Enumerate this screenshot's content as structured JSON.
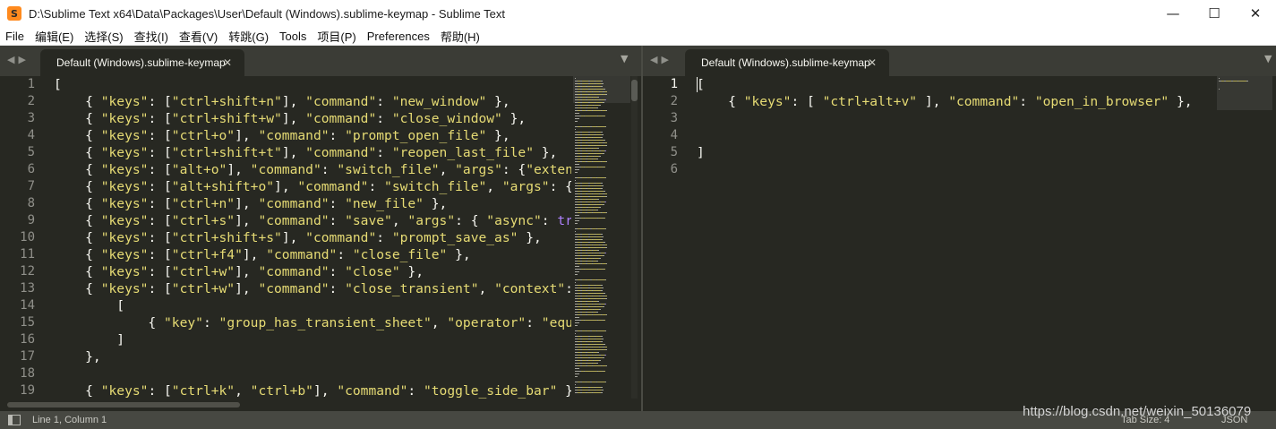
{
  "window": {
    "title": "D:\\Sublime Text x64\\Data\\Packages\\User\\Default (Windows).sublime-keymap - Sublime Text",
    "icon": "sublime-logo-icon",
    "controls": [
      "—",
      "☐",
      "✕"
    ]
  },
  "menu": [
    "File",
    "编辑(E)",
    "选择(S)",
    "查找(I)",
    "查看(V)",
    "转跳(G)",
    "Tools",
    "项目(P)",
    "Preferences",
    "帮助(H)"
  ],
  "left_pane": {
    "tab_label": "Default (Windows).sublime-keymap",
    "line_numbers": [
      "1",
      "2",
      "3",
      "4",
      "5",
      "6",
      "7",
      "8",
      "9",
      "10",
      "11",
      "12",
      "13",
      "14",
      "15",
      "16",
      "17",
      "18",
      "19"
    ],
    "lines": [
      [
        {
          "t": "[",
          "k": "p"
        }
      ],
      [
        {
          "t": "    { ",
          "k": "p"
        },
        {
          "t": "\"keys\"",
          "k": "s"
        },
        {
          "t": ": [",
          "k": "p"
        },
        {
          "t": "\"ctrl+shift+n\"",
          "k": "s"
        },
        {
          "t": "], ",
          "k": "p"
        },
        {
          "t": "\"command\"",
          "k": "s"
        },
        {
          "t": ": ",
          "k": "p"
        },
        {
          "t": "\"new_window\"",
          "k": "s"
        },
        {
          "t": " },",
          "k": "p"
        }
      ],
      [
        {
          "t": "    { ",
          "k": "p"
        },
        {
          "t": "\"keys\"",
          "k": "s"
        },
        {
          "t": ": [",
          "k": "p"
        },
        {
          "t": "\"ctrl+shift+w\"",
          "k": "s"
        },
        {
          "t": "], ",
          "k": "p"
        },
        {
          "t": "\"command\"",
          "k": "s"
        },
        {
          "t": ": ",
          "k": "p"
        },
        {
          "t": "\"close_window\"",
          "k": "s"
        },
        {
          "t": " },",
          "k": "p"
        }
      ],
      [
        {
          "t": "    { ",
          "k": "p"
        },
        {
          "t": "\"keys\"",
          "k": "s"
        },
        {
          "t": ": [",
          "k": "p"
        },
        {
          "t": "\"ctrl+o\"",
          "k": "s"
        },
        {
          "t": "], ",
          "k": "p"
        },
        {
          "t": "\"command\"",
          "k": "s"
        },
        {
          "t": ": ",
          "k": "p"
        },
        {
          "t": "\"prompt_open_file\"",
          "k": "s"
        },
        {
          "t": " },",
          "k": "p"
        }
      ],
      [
        {
          "t": "    { ",
          "k": "p"
        },
        {
          "t": "\"keys\"",
          "k": "s"
        },
        {
          "t": ": [",
          "k": "p"
        },
        {
          "t": "\"ctrl+shift+t\"",
          "k": "s"
        },
        {
          "t": "], ",
          "k": "p"
        },
        {
          "t": "\"command\"",
          "k": "s"
        },
        {
          "t": ": ",
          "k": "p"
        },
        {
          "t": "\"reopen_last_file\"",
          "k": "s"
        },
        {
          "t": " },",
          "k": "p"
        }
      ],
      [
        {
          "t": "    { ",
          "k": "p"
        },
        {
          "t": "\"keys\"",
          "k": "s"
        },
        {
          "t": ": [",
          "k": "p"
        },
        {
          "t": "\"alt+o\"",
          "k": "s"
        },
        {
          "t": "], ",
          "k": "p"
        },
        {
          "t": "\"command\"",
          "k": "s"
        },
        {
          "t": ": ",
          "k": "p"
        },
        {
          "t": "\"switch_file\"",
          "k": "s"
        },
        {
          "t": ", ",
          "k": "p"
        },
        {
          "t": "\"args\"",
          "k": "s"
        },
        {
          "t": ": {",
          "k": "p"
        },
        {
          "t": "\"exten",
          "k": "s"
        }
      ],
      [
        {
          "t": "    { ",
          "k": "p"
        },
        {
          "t": "\"keys\"",
          "k": "s"
        },
        {
          "t": ": [",
          "k": "p"
        },
        {
          "t": "\"alt+shift+o\"",
          "k": "s"
        },
        {
          "t": "], ",
          "k": "p"
        },
        {
          "t": "\"command\"",
          "k": "s"
        },
        {
          "t": ": ",
          "k": "p"
        },
        {
          "t": "\"switch_file\"",
          "k": "s"
        },
        {
          "t": ", ",
          "k": "p"
        },
        {
          "t": "\"args\"",
          "k": "s"
        },
        {
          "t": ": {",
          "k": "p"
        }
      ],
      [
        {
          "t": "    { ",
          "k": "p"
        },
        {
          "t": "\"keys\"",
          "k": "s"
        },
        {
          "t": ": [",
          "k": "p"
        },
        {
          "t": "\"ctrl+n\"",
          "k": "s"
        },
        {
          "t": "], ",
          "k": "p"
        },
        {
          "t": "\"command\"",
          "k": "s"
        },
        {
          "t": ": ",
          "k": "p"
        },
        {
          "t": "\"new_file\"",
          "k": "s"
        },
        {
          "t": " },",
          "k": "p"
        }
      ],
      [
        {
          "t": "    { ",
          "k": "p"
        },
        {
          "t": "\"keys\"",
          "k": "s"
        },
        {
          "t": ": [",
          "k": "p"
        },
        {
          "t": "\"ctrl+s\"",
          "k": "s"
        },
        {
          "t": "], ",
          "k": "p"
        },
        {
          "t": "\"command\"",
          "k": "s"
        },
        {
          "t": ": ",
          "k": "p"
        },
        {
          "t": "\"save\"",
          "k": "s"
        },
        {
          "t": ", ",
          "k": "p"
        },
        {
          "t": "\"args\"",
          "k": "s"
        },
        {
          "t": ": { ",
          "k": "p"
        },
        {
          "t": "\"async\"",
          "k": "s"
        },
        {
          "t": ": ",
          "k": "p"
        },
        {
          "t": "tr",
          "k": "c"
        }
      ],
      [
        {
          "t": "    { ",
          "k": "p"
        },
        {
          "t": "\"keys\"",
          "k": "s"
        },
        {
          "t": ": [",
          "k": "p"
        },
        {
          "t": "\"ctrl+shift+s\"",
          "k": "s"
        },
        {
          "t": "], ",
          "k": "p"
        },
        {
          "t": "\"command\"",
          "k": "s"
        },
        {
          "t": ": ",
          "k": "p"
        },
        {
          "t": "\"prompt_save_as\"",
          "k": "s"
        },
        {
          "t": " },",
          "k": "p"
        }
      ],
      [
        {
          "t": "    { ",
          "k": "p"
        },
        {
          "t": "\"keys\"",
          "k": "s"
        },
        {
          "t": ": [",
          "k": "p"
        },
        {
          "t": "\"ctrl+f4\"",
          "k": "s"
        },
        {
          "t": "], ",
          "k": "p"
        },
        {
          "t": "\"command\"",
          "k": "s"
        },
        {
          "t": ": ",
          "k": "p"
        },
        {
          "t": "\"close_file\"",
          "k": "s"
        },
        {
          "t": " },",
          "k": "p"
        }
      ],
      [
        {
          "t": "    { ",
          "k": "p"
        },
        {
          "t": "\"keys\"",
          "k": "s"
        },
        {
          "t": ": [",
          "k": "p"
        },
        {
          "t": "\"ctrl+w\"",
          "k": "s"
        },
        {
          "t": "], ",
          "k": "p"
        },
        {
          "t": "\"command\"",
          "k": "s"
        },
        {
          "t": ": ",
          "k": "p"
        },
        {
          "t": "\"close\"",
          "k": "s"
        },
        {
          "t": " },",
          "k": "p"
        }
      ],
      [
        {
          "t": "    { ",
          "k": "p"
        },
        {
          "t": "\"keys\"",
          "k": "s"
        },
        {
          "t": ": [",
          "k": "p"
        },
        {
          "t": "\"ctrl+w\"",
          "k": "s"
        },
        {
          "t": "], ",
          "k": "p"
        },
        {
          "t": "\"command\"",
          "k": "s"
        },
        {
          "t": ": ",
          "k": "p"
        },
        {
          "t": "\"close_transient\"",
          "k": "s"
        },
        {
          "t": ", ",
          "k": "p"
        },
        {
          "t": "\"context\"",
          "k": "s"
        },
        {
          "t": ":",
          "k": "p"
        }
      ],
      [
        {
          "t": "        [",
          "k": "p"
        }
      ],
      [
        {
          "t": "            { ",
          "k": "p"
        },
        {
          "t": "\"key\"",
          "k": "s"
        },
        {
          "t": ": ",
          "k": "p"
        },
        {
          "t": "\"group_has_transient_sheet\"",
          "k": "s"
        },
        {
          "t": ", ",
          "k": "p"
        },
        {
          "t": "\"operator\"",
          "k": "s"
        },
        {
          "t": ": ",
          "k": "p"
        },
        {
          "t": "\"equ",
          "k": "s"
        }
      ],
      [
        {
          "t": "        ]",
          "k": "p"
        }
      ],
      [
        {
          "t": "    },",
          "k": "p"
        }
      ],
      [],
      [
        {
          "t": "    { ",
          "k": "p"
        },
        {
          "t": "\"keys\"",
          "k": "s"
        },
        {
          "t": ": [",
          "k": "p"
        },
        {
          "t": "\"ctrl+k\"",
          "k": "s"
        },
        {
          "t": ", ",
          "k": "p"
        },
        {
          "t": "\"ctrl+b\"",
          "k": "s"
        },
        {
          "t": "], ",
          "k": "p"
        },
        {
          "t": "\"command\"",
          "k": "s"
        },
        {
          "t": ": ",
          "k": "p"
        },
        {
          "t": "\"toggle_side_bar\"",
          "k": "s"
        },
        {
          "t": " }",
          "k": "p"
        }
      ]
    ]
  },
  "right_pane": {
    "tab_label": "Default (Windows).sublime-keymap",
    "line_numbers": [
      "1",
      "2",
      "3",
      "4",
      "5",
      "6"
    ],
    "active_line": 0,
    "lines": [
      [
        {
          "t": "[",
          "k": "p"
        }
      ],
      [
        {
          "t": "    { ",
          "k": "p"
        },
        {
          "t": "\"keys\"",
          "k": "s"
        },
        {
          "t": ": [ ",
          "k": "p"
        },
        {
          "t": "\"ctrl+alt+v\"",
          "k": "s"
        },
        {
          "t": " ], ",
          "k": "p"
        },
        {
          "t": "\"command\"",
          "k": "s"
        },
        {
          "t": ": ",
          "k": "p"
        },
        {
          "t": "\"open_in_browser\"",
          "k": "s"
        },
        {
          "t": " },",
          "k": "p"
        }
      ],
      [],
      [],
      [
        {
          "t": "]",
          "k": "p"
        }
      ],
      []
    ]
  },
  "status": {
    "position": "Line 1, Column 1",
    "tab_size": "Tab Size: 4",
    "syntax": "JSON"
  },
  "watermark": "https://blog.csdn.net/weixin_50136079",
  "colors": {
    "background": "#272822",
    "string": "#e6db74",
    "constant": "#ae81ff",
    "text": "#f8f8f2",
    "gutter": "#90908a",
    "statusbar": "#474842"
  }
}
